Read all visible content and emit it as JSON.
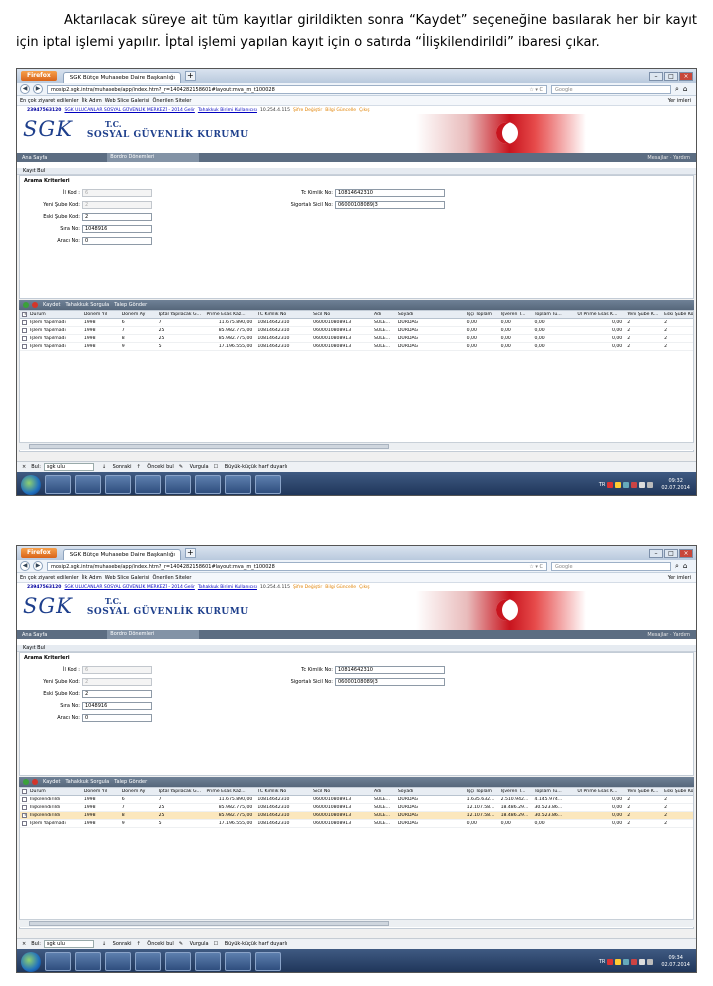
{
  "paragraph": "Aktarılacak süreye ait tüm kayıtlar girildikten sonra “Kaydet” seçeneğine basılarak her bir kayıt için iptal işlemi yapılır. İptal işlemi yapılan kayıt için o satırda “İlişkilendirildi” ibaresi çıkar.",
  "browser": {
    "firefox_label": "Firefox",
    "tab_title": "SGK Bütçe Muhasebe Daire Başkanlığı",
    "url": "mosip2.sgk.intra/muhasebe/app/index.htm?_r=1404282158601#layout:mva_m_t100028",
    "search_placeholder": "Google",
    "bookmarks": [
      "En çok ziyaret edilenler",
      "İlk Adım",
      "Web Slice Galerisi",
      "Önerilen Siteler"
    ],
    "bookmarks_right": "Yer imleri"
  },
  "infobar": {
    "id": "23947563120",
    "link": "SGK ULUCANLAR SOSYAL GÜVENLİK MERKEZİ - 2014 Gelir",
    "link2": "Tahakkuk Birimi Kullanıcısı",
    "ip": "10.254.4.115",
    "orange1": "Şifre Değiştir",
    "orange2": "Bilgi Güncelle",
    "orange3": "Çıkış"
  },
  "logo": {
    "sgk": "SGK",
    "tc": "T.C.",
    "kurum": "SOSYAL GÜVENLİK KURUMU"
  },
  "menu": {
    "home": "Ana Sayfa",
    "bordro": "Bordro Dönemleri",
    "right1": "Mesajlar",
    "right2": "Yardım"
  },
  "section": "Kayıt Bul",
  "panel_title": "Arama Kriterleri",
  "fields": {
    "il_kod_label": "İl Kod :",
    "il_kod": "6",
    "yeni_sube_label": "Yeni Şube Kod:",
    "yeni_sube": "2",
    "eski_sube_label": "Eski Şube Kod:",
    "eski_sube": "2",
    "sira_label": "Sıra No:",
    "sira": "1048916",
    "araci_label": "Aracı No:",
    "araci": "0",
    "tc_label": "Tc Kimlik No:",
    "tc": "10814642310",
    "sigortali_label": "Sigortalı Sicil No:",
    "sigortali": "06000108089|3"
  },
  "toolbar": {
    "save": "Kaydet",
    "tahakkuk": "Tahakkuk Sorgula",
    "talep": "Talep Gönder"
  },
  "columns": [
    "Durum",
    "Dönem Yıl",
    "Dönem Ay",
    "İptal Yapılacak G...",
    "Prime Esas Kaz...",
    "TC Kimlik No",
    "Sicil No",
    "Adı",
    "Soyadı",
    "İşçi Toplam",
    "İşveren T...",
    "Toplam Tu...",
    "Ul Prime Esas K...",
    "Yeni Şube K...",
    "Eski Şube Kod"
  ],
  "grid1": [
    [
      "İşlem Yapılmadı",
      "1998",
      "6",
      "7",
      "11.675.890,00",
      "10814642310",
      "0600010808913",
      "SÜLE...",
      "DURDAĞ",
      "0,00",
      "0,00",
      "0,00",
      "0,00",
      "2",
      "2"
    ],
    [
      "İşlem Yapılmadı",
      "1998",
      "7",
      "25",
      "85.982.775,00",
      "10814642310",
      "0600010808913",
      "SÜLE...",
      "DURDAĞ",
      "0,00",
      "0,00",
      "0,00",
      "0,00",
      "2",
      "2"
    ],
    [
      "İşlem Yapılmadı",
      "1998",
      "8",
      "25",
      "85.982.775,00",
      "10814642310",
      "0600010808913",
      "SÜLE...",
      "DURDAĞ",
      "0,00",
      "0,00",
      "0,00",
      "0,00",
      "2",
      "2"
    ],
    [
      "İşlem Yapılmadı",
      "1998",
      "9",
      "5",
      "17.196.555,00",
      "10814642310",
      "0600010808913",
      "SÜLE...",
      "DURDAĞ",
      "0,00",
      "0,00",
      "0,00",
      "0,00",
      "2",
      "2"
    ]
  ],
  "grid2": [
    [
      "İlişkilendirildi",
      "1998",
      "6",
      "7",
      "11.675.890,00",
      "10814642310",
      "0600010808913",
      "SÜLE...",
      "DURDAĞ",
      "1.635.632...",
      "2.510.942...",
      "4.145.974...",
      "0,00",
      "2",
      "2"
    ],
    [
      "İlişkilendirildi",
      "1998",
      "7",
      "25",
      "85.982.775,00",
      "10814642310",
      "0600010808913",
      "SÜLE...",
      "DURDAĞ",
      "12.107.58...",
      "18.486.29...",
      "30.523.86...",
      "0,00",
      "2",
      "2"
    ],
    [
      "İlişkilendirildi",
      "1998",
      "8",
      "25",
      "85.982.775,00",
      "10814642310",
      "0600010808913",
      "SÜLE...",
      "DURDAĞ",
      "12.107.58...",
      "18.486.29...",
      "30.523.86...",
      "0,00",
      "2",
      "2"
    ],
    [
      "İşlem Yapılmadı",
      "1998",
      "9",
      "5",
      "17.196.555,00",
      "10814642310",
      "0600010808913",
      "SÜLE...",
      "DURDAĞ",
      "0,00",
      "0,00",
      "0,00",
      "0,00",
      "2",
      "2"
    ]
  ],
  "grid2_selected_row": 2,
  "findbar": {
    "label": "Bul:",
    "value": "sgk ulu",
    "next": "Sonraki",
    "prev": "Önceki bul",
    "highlight": "Vurgula",
    "case": "Büyük-küçük harf duyarlı"
  },
  "tray": {
    "lang": "TR",
    "time1": "09:32",
    "time2": "09:34",
    "date": "02.07.2014"
  },
  "colors": {
    "sgk_blue": "#1e3f8c",
    "toolbar": "#5c6d82",
    "selected_row": "#fbe7bd"
  }
}
